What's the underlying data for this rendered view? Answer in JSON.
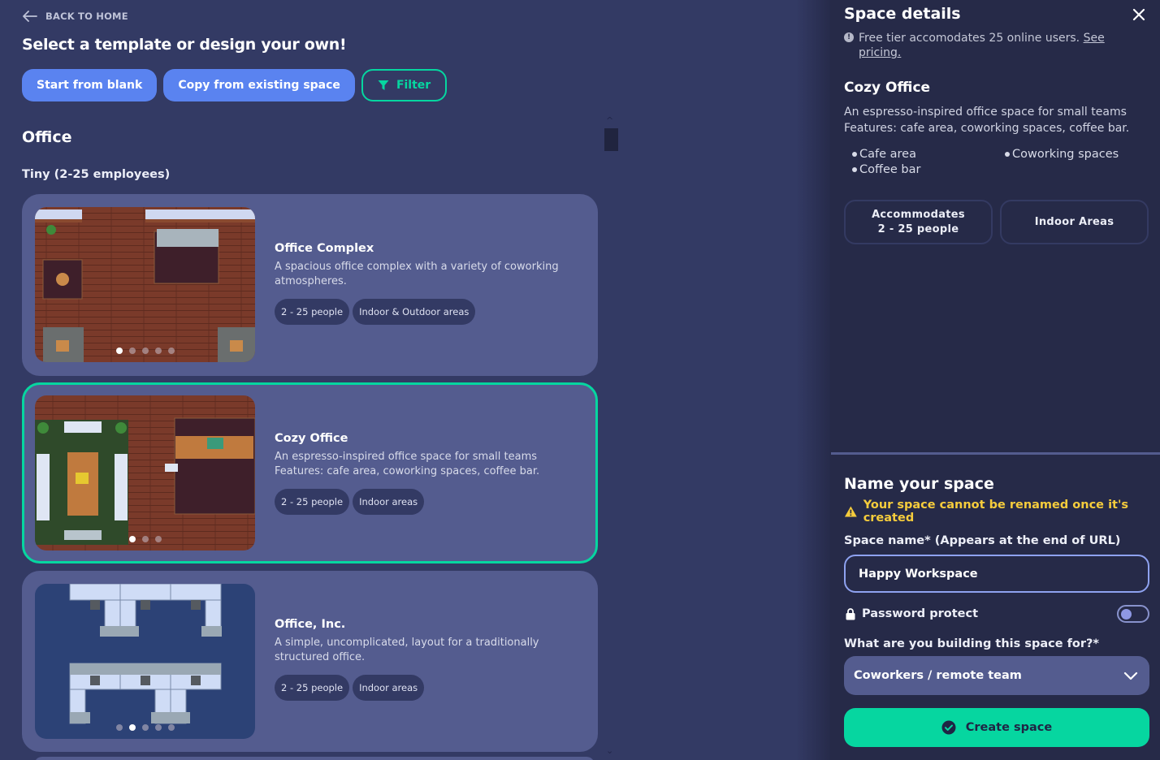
{
  "nav": {
    "back_label": "BACK TO HOME"
  },
  "header": {
    "title": "Select a template or design your own!",
    "buttons": {
      "start_blank": "Start from blank",
      "copy_existing": "Copy from existing space",
      "filter": "Filter"
    }
  },
  "section": {
    "title": "Office",
    "subtitle": "Tiny (2-25 employees)"
  },
  "templates": [
    {
      "name": "Office Complex",
      "description": "A spacious office complex with a variety of coworking atmospheres.",
      "tags": [
        "2 - 25 people",
        "Indoor & Outdoor areas"
      ],
      "slides": 5,
      "active_slide": 1,
      "selected": false
    },
    {
      "name": "Cozy Office",
      "description_lines": [
        "An espresso-inspired office space for small teams",
        "Features: cafe area, coworking spaces, coffee bar."
      ],
      "tags": [
        "2 - 25 people",
        "Indoor areas"
      ],
      "slides": 3,
      "active_slide": 1,
      "selected": true
    },
    {
      "name": "Office, Inc.",
      "description": "A simple, uncomplicated, layout for a traditionally structured office.",
      "tags": [
        "2 - 25 people",
        "Indoor areas"
      ],
      "slides": 5,
      "active_slide": 2,
      "selected": false
    }
  ],
  "details": {
    "title": "Space details",
    "info_text": "Free tier accomodates 25 online users.",
    "info_link": "See pricing.",
    "name": "Cozy Office",
    "description_lines": [
      "An espresso-inspired office space for small teams",
      "Features: cafe area, coworking spaces, coffee bar."
    ],
    "features": [
      "Cafe area",
      "Coworking spaces",
      "Coffee bar"
    ],
    "pills": {
      "capacity_line1": "Accommodates",
      "capacity_line2": "2 - 25 people",
      "areas": "Indoor Areas"
    }
  },
  "form": {
    "title": "Name your space",
    "warning": "Your space cannot be renamed once it's created",
    "name_label": "Space name* (Appears at the end of URL)",
    "name_value": "Happy Workspace",
    "password_label": "Password protect",
    "password_enabled": false,
    "purpose_label": "What are you building this space for?*",
    "purpose_value": "Coworkers / remote team",
    "create_label": "Create space"
  },
  "colors": {
    "accent_green": "#06d6a0",
    "button_blue": "#5a83f0",
    "warning_yellow": "#f5cc3c",
    "card_bg": "#545c8f",
    "page_bg": "#333a64",
    "panel_bg": "#262a48"
  }
}
